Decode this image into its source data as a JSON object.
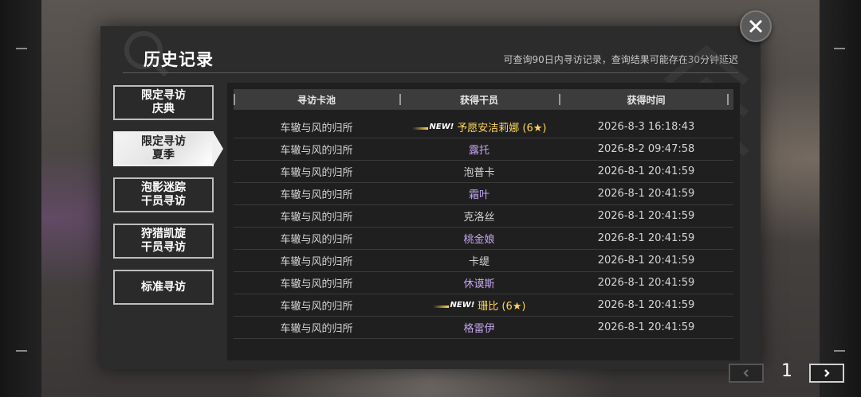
{
  "dialog": {
    "title": "历史记录",
    "hint": "可查询90日内寻访记录，查询结果可能存在30分钟延迟"
  },
  "tabs": [
    {
      "line1": "限定寻访",
      "line2": "庆典",
      "active": false
    },
    {
      "line1": "限定寻访",
      "line2": "夏季",
      "active": true
    },
    {
      "line1": "泡影迷踪",
      "line2": "干员寻访",
      "active": false
    },
    {
      "line1": "狩猎凯旋",
      "line2": "干员寻访",
      "active": false
    },
    {
      "line1": "标准寻访",
      "line2": "",
      "active": false
    }
  ],
  "table": {
    "headers": [
      "寻访卡池",
      "获得干员",
      "获得时间"
    ],
    "rows": [
      {
        "pool": "车辙与风的归所",
        "operator": "予愿安洁莉娜 (6★)",
        "time": "2026-8-3 16:18:43",
        "new": "NEW!",
        "rarity": "gold"
      },
      {
        "pool": "车辙与风的归所",
        "operator": "露托",
        "time": "2026-8-2 09:47:58",
        "new": "",
        "rarity": "purple"
      },
      {
        "pool": "车辙与风的归所",
        "operator": "泡普卡",
        "time": "2026-8-1 20:41:59",
        "new": "",
        "rarity": "white"
      },
      {
        "pool": "车辙与风的归所",
        "operator": "霜叶",
        "time": "2026-8-1 20:41:59",
        "new": "",
        "rarity": "purple"
      },
      {
        "pool": "车辙与风的归所",
        "operator": "克洛丝",
        "time": "2026-8-1 20:41:59",
        "new": "",
        "rarity": "white"
      },
      {
        "pool": "车辙与风的归所",
        "operator": "桃金娘",
        "time": "2026-8-1 20:41:59",
        "new": "",
        "rarity": "purple"
      },
      {
        "pool": "车辙与风的归所",
        "operator": "卡缇",
        "time": "2026-8-1 20:41:59",
        "new": "",
        "rarity": "white"
      },
      {
        "pool": "车辙与风的归所",
        "operator": "休谟斯",
        "time": "2026-8-1 20:41:59",
        "new": "",
        "rarity": "purple"
      },
      {
        "pool": "车辙与风的归所",
        "operator": "珊比 (6★)",
        "time": "2026-8-1 20:41:59",
        "new": "NEW!",
        "rarity": "gold"
      },
      {
        "pool": "车辙与风的归所",
        "operator": "格雷伊",
        "time": "2026-8-1 20:41:59",
        "new": "",
        "rarity": "purple"
      }
    ]
  },
  "pagination": {
    "current": "1",
    "prev_icon": "chevron-left-icon",
    "next_icon": "chevron-right-icon"
  },
  "colors": {
    "gold": "#ffd45a",
    "purple": "#c5a6ef",
    "white": "#d4d4d4"
  }
}
